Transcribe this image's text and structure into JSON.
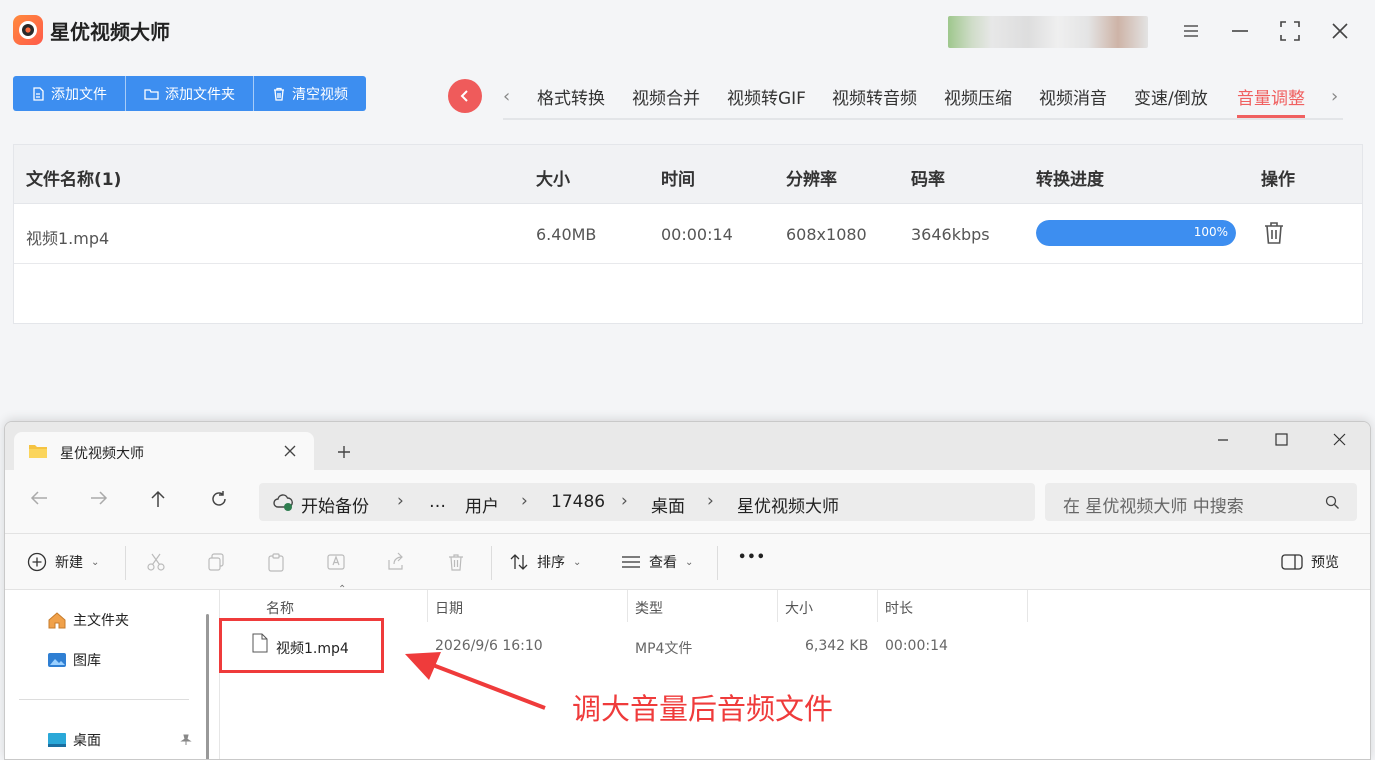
{
  "app": {
    "title": "星优视频大师",
    "toolbar": {
      "add_file": "添加文件",
      "add_folder": "添加文件夹",
      "clear_video": "清空视频"
    },
    "tabs": [
      "格式转换",
      "视频合并",
      "视频转GIF",
      "视频转音频",
      "视频压缩",
      "视频消音",
      "变速/倒放",
      "音量调整"
    ],
    "active_tab": "音量调整",
    "table": {
      "headers": {
        "name": "文件名称(1)",
        "size": "大小",
        "time": "时间",
        "resolution": "分辨率",
        "bitrate": "码率",
        "progress": "转换进度",
        "action": "操作"
      },
      "rows": [
        {
          "name": "视频1.mp4",
          "size": "6.40MB",
          "time": "00:00:14",
          "resolution": "608x1080",
          "bitrate": "3646kbps",
          "progress_label": "100%",
          "progress_value": 1.0
        }
      ]
    },
    "colors": {
      "accent": "#3d8ef0",
      "active_tab": "#f06060",
      "back_button": "#ef5b5b"
    }
  },
  "explorer": {
    "tab_title": "星优视频大师",
    "breadcrumb": [
      "开始备份",
      "…",
      "用户",
      "17486",
      "桌面",
      "星优视频大师"
    ],
    "search_placeholder": "在 星优视频大师 中搜索",
    "commands": {
      "new": "新建",
      "sort": "排序",
      "view": "查看",
      "more": "•••",
      "preview": "预览"
    },
    "sidebar": [
      "主文件夹",
      "图库",
      "桌面"
    ],
    "columns": {
      "name": "名称",
      "date": "日期",
      "type": "类型",
      "size": "大小",
      "duration": "时长"
    },
    "files": [
      {
        "name": "视频1.mp4",
        "date": "2026/9/6 16:10",
        "type": "MP4文件",
        "size": "6,342 KB",
        "duration": "00:00:14"
      }
    ]
  },
  "annotation": {
    "text": "调大音量后音频文件",
    "color": "#ef3b3b"
  }
}
